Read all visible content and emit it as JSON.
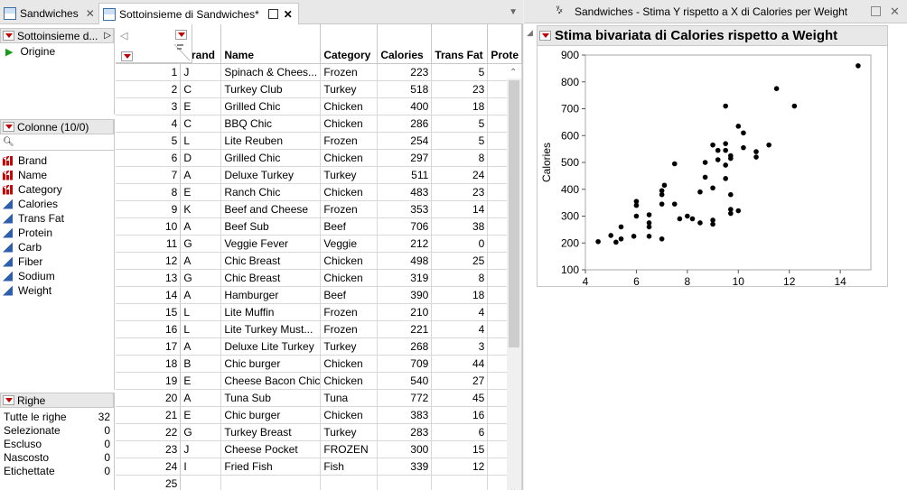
{
  "tabs": [
    {
      "label": "Sandwiches",
      "active": false
    },
    {
      "label": "Sottoinsieme di Sandwiches*",
      "active": true
    }
  ],
  "panels": {
    "subset": {
      "title": "Sottoinsieme d...",
      "items": [
        "Origine"
      ]
    },
    "columns": {
      "title": "Colonne (10/0)",
      "items": [
        {
          "name": "Brand",
          "type": "nominal"
        },
        {
          "name": "Name",
          "type": "nominal"
        },
        {
          "name": "Category",
          "type": "nominal"
        },
        {
          "name": "Calories",
          "type": "continuous"
        },
        {
          "name": "Trans Fat",
          "type": "continuous"
        },
        {
          "name": "Protein",
          "type": "continuous"
        },
        {
          "name": "Carb",
          "type": "continuous"
        },
        {
          "name": "Fiber",
          "type": "continuous"
        },
        {
          "name": "Sodium",
          "type": "continuous"
        },
        {
          "name": "Weight",
          "type": "continuous"
        }
      ]
    },
    "rows": {
      "title": "Righe",
      "items": [
        {
          "label": "Tutte le righe",
          "value": "32"
        },
        {
          "label": "Selezionate",
          "value": "0"
        },
        {
          "label": "Escluso",
          "value": "0"
        },
        {
          "label": "Nascosto",
          "value": "0"
        },
        {
          "label": "Etichettate",
          "value": "0"
        }
      ]
    }
  },
  "table": {
    "headers": [
      "Brand",
      "Name",
      "Category",
      "Calories",
      "Trans Fat",
      "Prote"
    ],
    "rows": [
      [
        "1",
        "J",
        "Spinach & Chees...",
        "Frozen",
        "223",
        "5"
      ],
      [
        "2",
        "C",
        "Turkey Club",
        "Turkey",
        "518",
        "23"
      ],
      [
        "3",
        "E",
        "Grilled Chic",
        "Chicken",
        "400",
        "18"
      ],
      [
        "4",
        "C",
        "BBQ Chic",
        "Chicken",
        "286",
        "5"
      ],
      [
        "5",
        "L",
        "Lite Reuben",
        "Frozen",
        "254",
        "5"
      ],
      [
        "6",
        "D",
        "Grilled Chic",
        "Chicken",
        "297",
        "8"
      ],
      [
        "7",
        "A",
        "Deluxe Turkey",
        "Turkey",
        "511",
        "24"
      ],
      [
        "8",
        "E",
        "Ranch Chic",
        "Chicken",
        "483",
        "23"
      ],
      [
        "9",
        "K",
        "Beef and Cheese",
        "Frozen",
        "353",
        "14"
      ],
      [
        "10",
        "A",
        "Beef Sub",
        "Beef",
        "706",
        "38"
      ],
      [
        "11",
        "G",
        "Veggie Fever",
        "Veggie",
        "212",
        "0"
      ],
      [
        "12",
        "A",
        "Chic Breast",
        "Chicken",
        "498",
        "25"
      ],
      [
        "13",
        "G",
        "Chic Breast",
        "Chicken",
        "319",
        "8"
      ],
      [
        "14",
        "A",
        "Hamburger",
        "Beef",
        "390",
        "18"
      ],
      [
        "15",
        "L",
        "Lite Muffin",
        "Frozen",
        "210",
        "4"
      ],
      [
        "16",
        "L",
        "Lite Turkey Must...",
        "Frozen",
        "221",
        "4"
      ],
      [
        "17",
        "A",
        "Deluxe Lite Turkey",
        "Turkey",
        "268",
        "3"
      ],
      [
        "18",
        "B",
        "Chic burger",
        "Chicken",
        "709",
        "44"
      ],
      [
        "19",
        "E",
        "Cheese Bacon Chic",
        "Chicken",
        "540",
        "27"
      ],
      [
        "20",
        "A",
        "Tuna Sub",
        "Tuna",
        "772",
        "45"
      ],
      [
        "21",
        "E",
        "Chic burger",
        "Chicken",
        "383",
        "16"
      ],
      [
        "22",
        "G",
        "Turkey Breast",
        "Turkey",
        "283",
        "6"
      ],
      [
        "23",
        "J",
        "Cheese Pocket",
        "FROZEN",
        "300",
        "15"
      ],
      [
        "24",
        "I",
        "Fried Fish",
        "Fish",
        "339",
        "12"
      ],
      [
        "25",
        "",
        "",
        "",
        "",
        ""
      ]
    ]
  },
  "report": {
    "window_title": "Sandwiches - Stima Y rispetto a X di Calories per Weight",
    "heading": "Stima bivariata di Calories rispetto a Weight"
  },
  "chart_data": {
    "type": "scatter",
    "xlabel": "Weight",
    "ylabel": "Calories",
    "xlim": [
      4,
      15.2
    ],
    "ylim": [
      100,
      900
    ],
    "xticks": [
      "4",
      "6",
      "8",
      "10",
      "12",
      "14"
    ],
    "yticks": [
      "100",
      "200",
      "300",
      "400",
      "500",
      "600",
      "700",
      "800",
      "900"
    ],
    "points": [
      [
        4.5,
        205
      ],
      [
        5.0,
        228
      ],
      [
        5.2,
        203
      ],
      [
        5.4,
        215
      ],
      [
        5.4,
        260
      ],
      [
        5.9,
        225
      ],
      [
        6.0,
        300
      ],
      [
        6.0,
        340
      ],
      [
        6.0,
        355
      ],
      [
        6.5,
        225
      ],
      [
        6.5,
        260
      ],
      [
        6.5,
        275
      ],
      [
        6.5,
        305
      ],
      [
        7.0,
        215
      ],
      [
        7.0,
        345
      ],
      [
        7.0,
        380
      ],
      [
        7.0,
        395
      ],
      [
        7.1,
        415
      ],
      [
        7.5,
        345
      ],
      [
        7.5,
        495
      ],
      [
        7.7,
        290
      ],
      [
        8.0,
        300
      ],
      [
        8.2,
        290
      ],
      [
        8.5,
        275
      ],
      [
        8.5,
        390
      ],
      [
        8.7,
        445
      ],
      [
        8.7,
        500
      ],
      [
        9.0,
        270
      ],
      [
        9.0,
        285
      ],
      [
        9.0,
        405
      ],
      [
        9.0,
        565
      ],
      [
        9.2,
        510
      ],
      [
        9.2,
        545
      ],
      [
        9.5,
        440
      ],
      [
        9.5,
        490
      ],
      [
        9.5,
        545
      ],
      [
        9.5,
        570
      ],
      [
        9.5,
        710
      ],
      [
        9.7,
        310
      ],
      [
        9.7,
        325
      ],
      [
        9.7,
        380
      ],
      [
        9.7,
        515
      ],
      [
        9.7,
        525
      ],
      [
        10.0,
        320
      ],
      [
        10.0,
        635
      ],
      [
        10.2,
        555
      ],
      [
        10.2,
        610
      ],
      [
        10.7,
        520
      ],
      [
        10.7,
        540
      ],
      [
        11.2,
        565
      ],
      [
        11.5,
        775
      ],
      [
        12.2,
        710
      ],
      [
        14.7,
        860
      ]
    ]
  }
}
